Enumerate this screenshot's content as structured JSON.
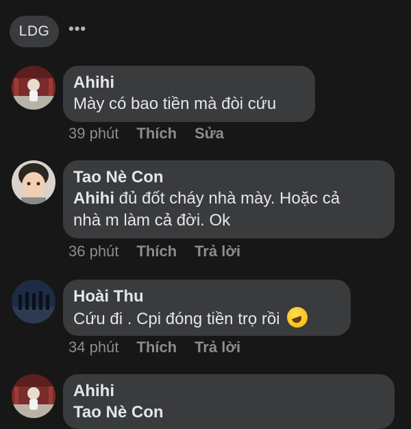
{
  "header": {
    "page_avatar_label": "LDG",
    "more_icon": "more-horizontal-icon"
  },
  "comments": [
    {
      "author": "Ahihi",
      "text": "Mày có bao tiền mà đòi cứu",
      "time": "39 phút",
      "like_label": "Thích",
      "action_label": "Sửa"
    },
    {
      "author": "Tao Nè Con",
      "mention": "Ahihi",
      "text_line1": " đủ đốt cháy nhà mày. Hoặc cả",
      "text_line2": "nhà m làm cả đời. Ok",
      "time": "36 phút",
      "like_label": "Thích",
      "action_label": "Trả lời"
    },
    {
      "author": "Hoài Thu",
      "text": "Cứu đi . Cpi đóng tiền trọ rồi",
      "emoji": "rolling-on-floor-laughing-emoji",
      "time": "34 phút",
      "like_label": "Thích",
      "action_label": "Trả lời"
    },
    {
      "author": "Ahihi",
      "partial_text": "Tao Nè Con"
    }
  ]
}
